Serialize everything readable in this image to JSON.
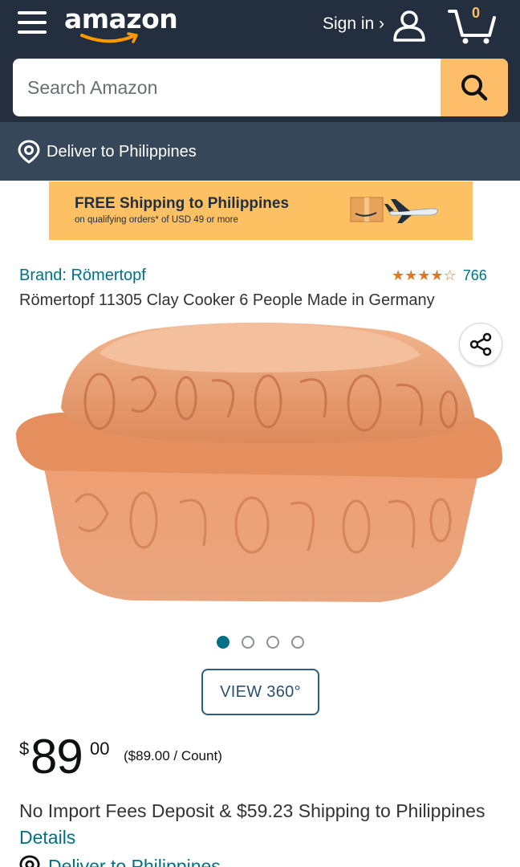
{
  "header": {
    "logo_text": "amazon",
    "signin_label": "Sign in ›",
    "cart_count": "0",
    "search_placeholder": "Search Amazon",
    "deliver_label": "Deliver to Philippines"
  },
  "banner": {
    "title": "FREE Shipping to Philippines",
    "subtitle": "on qualifying orders* of USD 49 or more"
  },
  "product": {
    "brand": "Brand: Römertopf",
    "stars": "★★★★☆",
    "rating_value": 4.5,
    "rating_count": "766",
    "title": "Römertopf 11305 Clay Cooker 6 People Made in Germany",
    "image_icon": "clay-cooker-image",
    "carousel_total": 4,
    "carousel_active": 0,
    "view360_label": "VIEW 360°"
  },
  "price": {
    "symbol": "$",
    "whole": "89",
    "fraction": "00",
    "unit_price": "($89.00 / Count)"
  },
  "shipping": {
    "import_text": "No Import Fees Deposit & $59.23 Shipping to Philippines ",
    "details_link": "Details",
    "deliver_bottom": "Deliver to Philippines"
  },
  "colors": {
    "header_bg": "#232f3e",
    "deliver_bg": "#37475a",
    "search_button": "#febd69",
    "banner_bg": "#fdc063",
    "link": "#007185",
    "star": "#de7921"
  }
}
